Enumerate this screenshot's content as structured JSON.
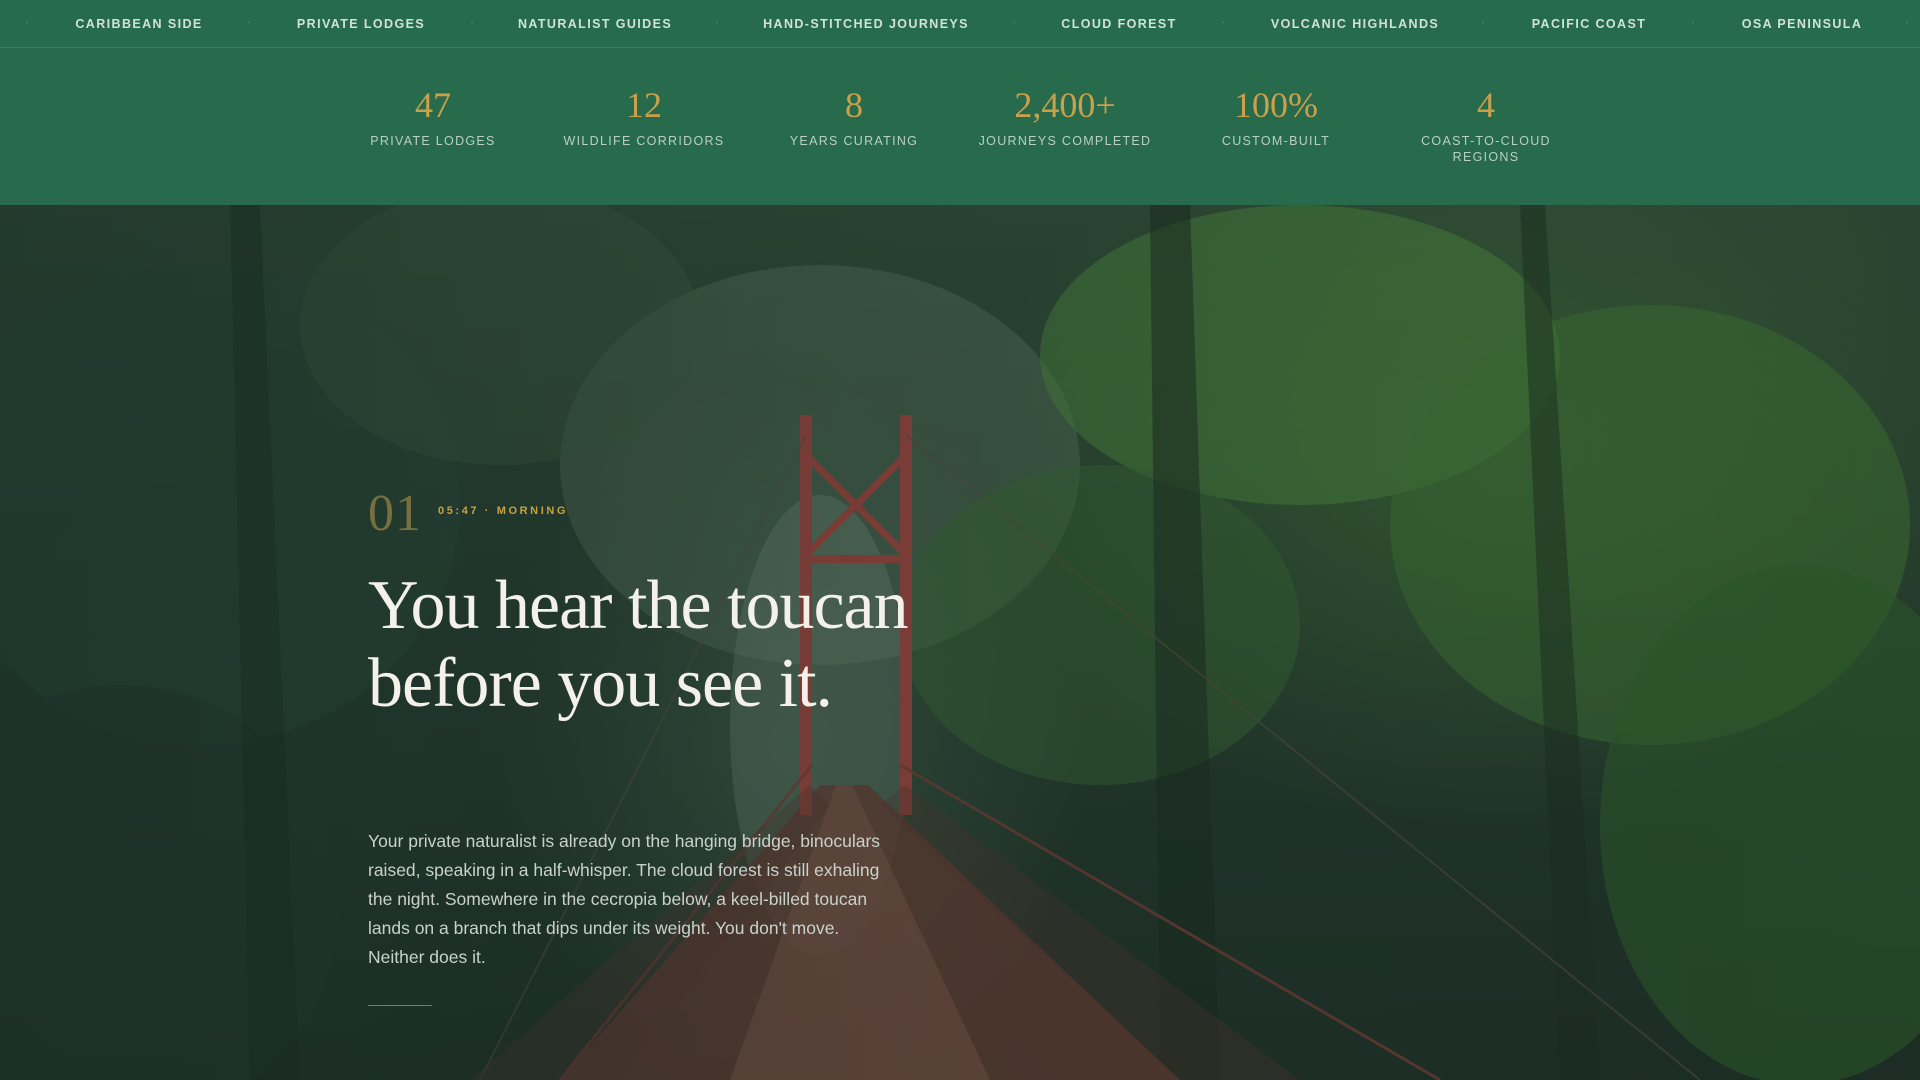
{
  "nav": {
    "items": [
      {
        "label": "CARIBBEAN SIDE"
      },
      {
        "label": "PRIVATE LODGES"
      },
      {
        "label": "NATURALIST GUIDES"
      },
      {
        "label": "HAND-STITCHED JOURNEYS"
      },
      {
        "label": "CLOUD FOREST"
      },
      {
        "label": "VOLCANIC HIGHLANDS"
      },
      {
        "label": "PACIFIC COAST"
      },
      {
        "label": "OSA PENINSULA"
      }
    ],
    "separator": "·"
  },
  "stats": [
    {
      "value": "47",
      "label": "PRIVATE LODGES"
    },
    {
      "value": "12",
      "label": "WILDLIFE CORRIDORS"
    },
    {
      "value": "8",
      "label": "YEARS CURATING"
    },
    {
      "value": "2,400+",
      "label": "JOURNEYS COMPLETED"
    },
    {
      "value": "100%",
      "label": "CUSTOM-BUILT"
    },
    {
      "value": "4",
      "label": "COAST-TO-CLOUD REGIONS"
    }
  ],
  "hero": {
    "chapter_number": "01",
    "time_label": "05:47 · MORNING",
    "headline": "You hear the toucan before you see it.",
    "body": "Your private naturalist is already on the hanging bridge, binoculars raised, speaking in a half-whisper. The cloud forest is still exhaling the night. Somewhere in the cecropia below, a keel-billed toucan lands on a branch that dips under its weight. You don't move. Neither does it.",
    "image_subject": "hanging-bridge-cloud-forest"
  },
  "colors": {
    "brand_green": "#276b4d",
    "accent_gold": "#caa14a",
    "divider_teal": "#3f8f7a"
  }
}
